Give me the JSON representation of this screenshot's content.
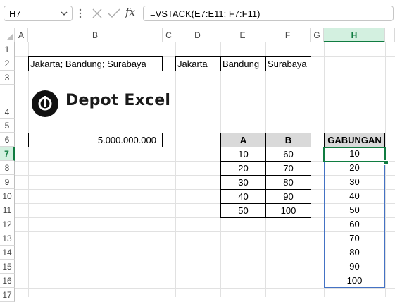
{
  "formula_bar": {
    "name_box": "H7",
    "insert_function_glyph": "fx",
    "formula": "=VSTACK(E7:E11; F7:F11)"
  },
  "columns": [
    "A",
    "B",
    "C",
    "D",
    "E",
    "F",
    "G",
    "H"
  ],
  "selected_column": "H",
  "rows": [
    "1",
    "2",
    "3",
    "4",
    "5",
    "6",
    "7",
    "8",
    "9",
    "10",
    "11",
    "12",
    "13",
    "14",
    "15",
    "16",
    "17"
  ],
  "selected_row": "7",
  "cells": {
    "B2": "Jakarta; Bandung; Surabaya",
    "D2": "Jakarta",
    "E2": "Bandung",
    "F2": "Surabaya",
    "B6": "5.000.000.000"
  },
  "logo": {
    "text": "Depot Excel",
    "icon": "depot-excel-logo-icon"
  },
  "table": {
    "headers": [
      "A",
      "B"
    ],
    "rows": [
      [
        "10",
        "60"
      ],
      [
        "20",
        "70"
      ],
      [
        "30",
        "80"
      ],
      [
        "40",
        "90"
      ],
      [
        "50",
        "100"
      ]
    ]
  },
  "result": {
    "header": "GABUNGAN",
    "values": [
      "10",
      "20",
      "30",
      "40",
      "50",
      "60",
      "70",
      "80",
      "90",
      "100"
    ]
  },
  "colors": {
    "selection": "#107c41",
    "spill_border": "#4472c4",
    "header_fill": "#d9d9d9"
  }
}
